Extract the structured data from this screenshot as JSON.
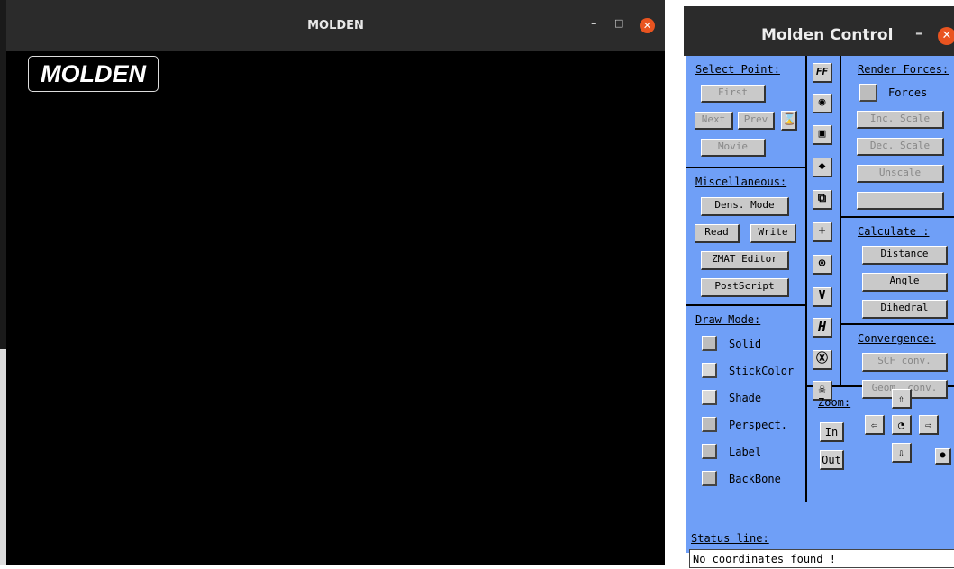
{
  "main_window": {
    "title": "MOLDEN",
    "logo": "MOLDEN",
    "minimize_glyph": "–",
    "maximize_glyph": "□",
    "close_glyph": "✕"
  },
  "control_window": {
    "title": "Molden Control",
    "minimize_glyph": "–",
    "close_glyph": "✕",
    "select_point": {
      "heading": "Select Point:",
      "first": "First",
      "next": "Next",
      "prev": "Prev",
      "movie": "Movie",
      "hourglass_icon": "⌛"
    },
    "misc": {
      "heading": "Miscellaneous:",
      "dens_mode": "Dens. Mode",
      "read": "Read",
      "write": "Write",
      "zmat": "ZMAT Editor",
      "postscript": "PostScript"
    },
    "draw_mode": {
      "heading": "Draw Mode:",
      "items": [
        {
          "label": "Solid"
        },
        {
          "label": "StickColor"
        },
        {
          "label": "Shade"
        },
        {
          "label": "Perspect."
        },
        {
          "label": "Label"
        },
        {
          "label": "BackBone"
        }
      ]
    },
    "icons": {
      "ff": "FF",
      "camera": "◉",
      "video_camera": "▣",
      "bird": "◆",
      "cube": "⧉",
      "axes": "+",
      "orbital": "⊚",
      "vector": "V",
      "h_bond": "H",
      "ring": "Ⓧ",
      "skull": "☠"
    },
    "render_forces": {
      "heading": "Render Forces:",
      "forces": "Forces",
      "btn1": "Inc. Scale",
      "btn2": "Dec. Scale",
      "btn3": "Unscale",
      "btn4": ""
    },
    "calculate": {
      "heading": "Calculate :",
      "distance": "Distance",
      "angle": "Angle",
      "dihedral": "Dihedral"
    },
    "convergence": {
      "heading": "Convergence:",
      "scf": "SCF conv.",
      "geom": "Geom. conv."
    },
    "zoom": {
      "heading": "Zoom:",
      "in": "In",
      "out": "Out",
      "up": "⇧",
      "down": "⇩",
      "left": "⇦",
      "right": "⇨",
      "center": "◔",
      "dot": "●"
    },
    "status": {
      "label": "Status line:",
      "text": "No coordinates found !"
    }
  }
}
